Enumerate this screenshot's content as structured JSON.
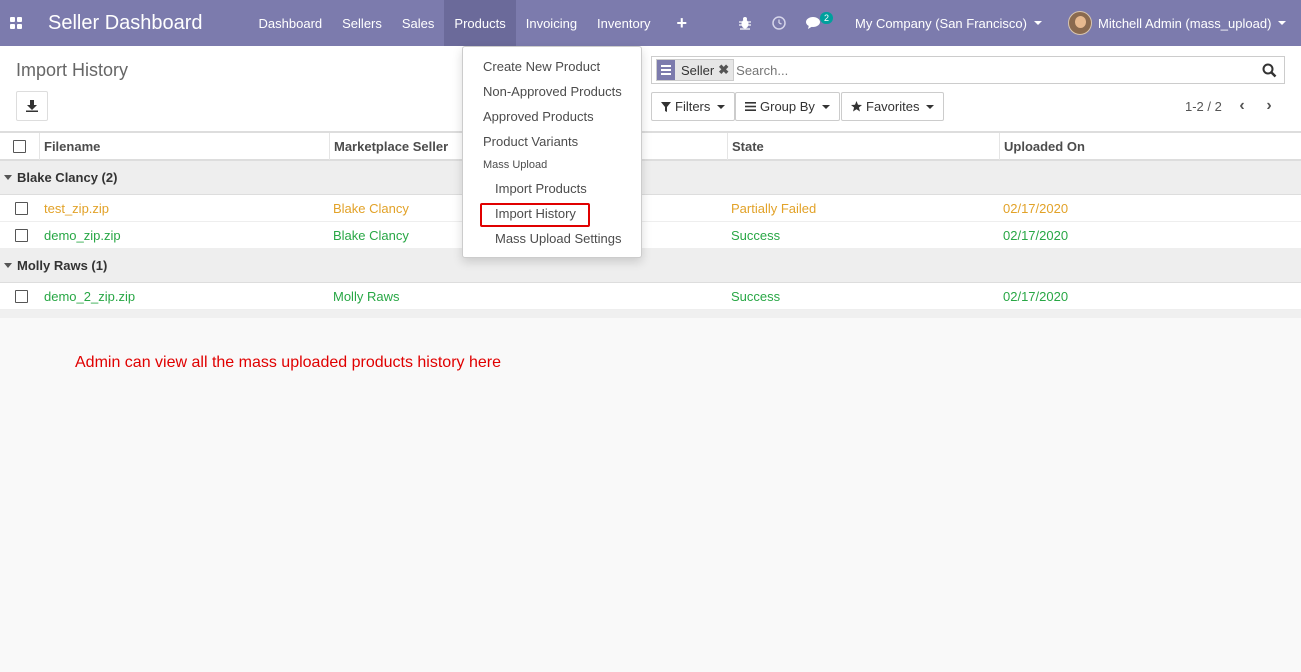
{
  "navbar": {
    "brand": "Seller Dashboard",
    "menu": [
      "Dashboard",
      "Sellers",
      "Sales",
      "Products",
      "Invoicing",
      "Inventory"
    ],
    "active_menu": "Products",
    "messages_count": "2",
    "company": "My Company (San Francisco)",
    "user": "Mitchell Admin (mass_upload)",
    "bg_color": "#7c7bad"
  },
  "control_panel": {
    "breadcrumb": "Import History",
    "search": {
      "facet_label": "Seller",
      "placeholder": "Search..."
    },
    "filters_label": "Filters",
    "group_by_label": "Group By",
    "favorites_label": "Favorites",
    "pager": "1-2 / 2"
  },
  "table": {
    "columns": [
      "Filename",
      "Marketplace Seller",
      "State",
      "Uploaded On"
    ],
    "groups": [
      {
        "title": "Blake Clancy (2)",
        "rows": [
          {
            "filename": "test_zip.zip",
            "seller": "Blake Clancy",
            "state": "Partially Failed",
            "uploaded_on": "02/17/2020",
            "color": "#e2a228"
          },
          {
            "filename": "demo_zip.zip",
            "seller": "Blake Clancy",
            "state": "Success",
            "uploaded_on": "02/17/2020",
            "color": "#28a745"
          }
        ]
      },
      {
        "title": "Molly Raws (1)",
        "rows": [
          {
            "filename": "demo_2_zip.zip",
            "seller": "Molly Raws",
            "state": "Success",
            "uploaded_on": "02/17/2020",
            "color": "#28a745"
          }
        ]
      }
    ]
  },
  "products_menu": {
    "items": [
      "Create New Product",
      "Non-Approved Products",
      "Approved Products",
      "Product Variants"
    ],
    "section_header": "Mass Upload",
    "sub_items": [
      "Import Products",
      "Import History",
      "Mass Upload Settings"
    ],
    "highlighted": "Import History",
    "highlight_color": "#e00000"
  },
  "annotation": "Admin can view all the mass uploaded products history here"
}
